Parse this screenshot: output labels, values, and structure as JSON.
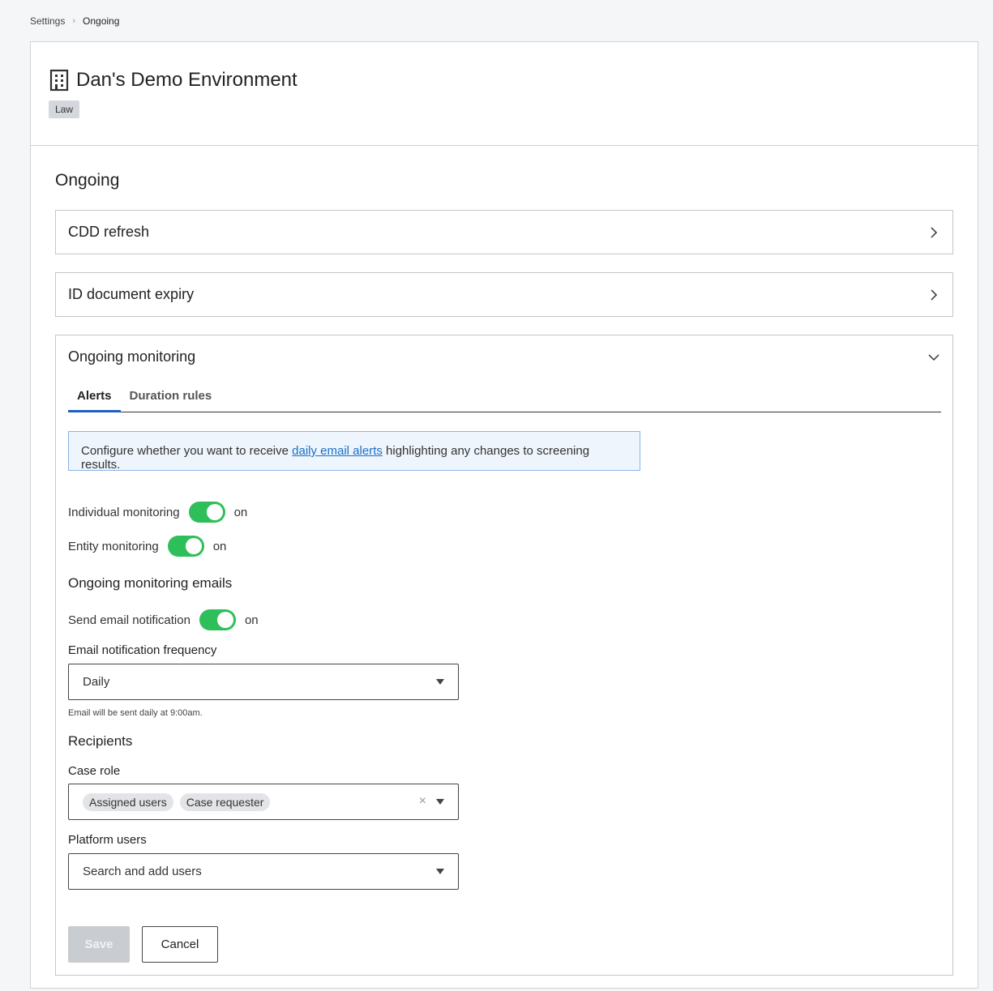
{
  "breadcrumb": {
    "parent": "Settings",
    "current": "Ongoing"
  },
  "header": {
    "environment_name": "Dan's Demo Environment",
    "tag": "Law"
  },
  "section": {
    "title": "Ongoing"
  },
  "accordions": {
    "cdd_refresh": {
      "label": "CDD refresh",
      "expanded": false
    },
    "id_expiry": {
      "label": "ID document expiry",
      "expanded": false
    },
    "ongoing_monitoring": {
      "label": "Ongoing monitoring",
      "expanded": true
    }
  },
  "tabs": {
    "alerts": "Alerts",
    "duration_rules": "Duration rules",
    "active": "Alerts"
  },
  "info": {
    "before": "Configure whether you want to receive ",
    "link": "daily email alerts",
    "after": " highlighting any changes to screening results."
  },
  "toggles": {
    "individual": {
      "label": "Individual monitoring",
      "state": "on"
    },
    "entity": {
      "label": "Entity monitoring",
      "state": "on"
    },
    "email": {
      "label": "Send email notification",
      "state": "on"
    }
  },
  "emails_heading": "Ongoing monitoring emails",
  "frequency": {
    "label": "Email notification frequency",
    "value": "Daily",
    "helper": "Email will be sent daily at 9:00am."
  },
  "recipients": {
    "heading": "Recipients",
    "case_role_label": "Case role",
    "case_role_chips": [
      "Assigned users",
      "Case requester"
    ],
    "platform_users_label": "Platform users",
    "platform_users_placeholder": "Search and add users"
  },
  "actions": {
    "save": "Save",
    "cancel": "Cancel"
  },
  "colors": {
    "toggle_on": "#2fbf5a",
    "tab_active": "#1f5fc4",
    "link": "#1a6ec7",
    "info_bg": "#eef5fd"
  }
}
